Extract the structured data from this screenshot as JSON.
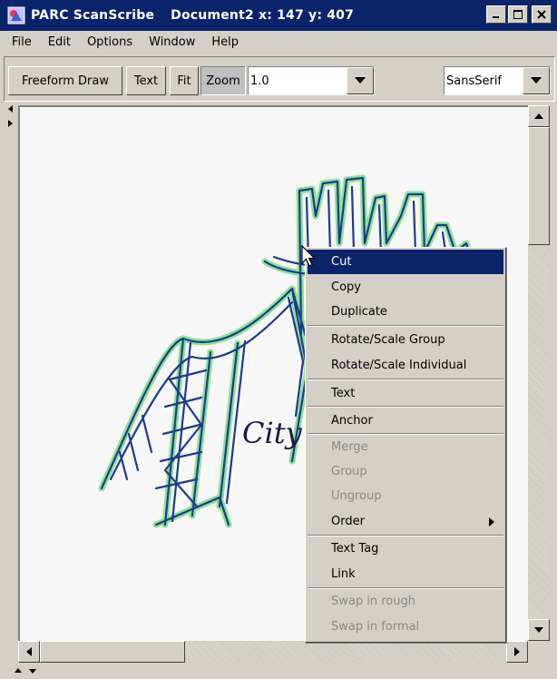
{
  "window": {
    "app_title": "PARC ScanScribe",
    "doc_title": "Document2 x: 147 y: 407"
  },
  "menubar": {
    "items": [
      "File",
      "Edit",
      "Options",
      "Window",
      "Help"
    ]
  },
  "toolbar": {
    "freeform_label": "Freeform Draw",
    "text_label": "Text",
    "fit_label": "Fit",
    "zoom_label": "Zoom",
    "zoom_value": "1.0",
    "font_value": "SansSerif"
  },
  "canvas": {
    "sketch_text": "City"
  },
  "context_menu": {
    "cut": "Cut",
    "copy": "Copy",
    "duplicate": "Duplicate",
    "rotate_group": "Rotate/Scale Group",
    "rotate_individual": "Rotate/Scale Individual",
    "text": "Text",
    "anchor": "Anchor",
    "merge": "Merge",
    "group": "Group",
    "ungroup": "Ungroup",
    "order": "Order",
    "text_tag": "Text Tag",
    "link": "Link",
    "swap_rough": "Swap in rough",
    "swap_formal": "Swap in formal"
  },
  "colors": {
    "titlebar": "#0a246a",
    "highlight": "#0a246a",
    "sketch_ink": "#1e3a8a",
    "sketch_glow": "#7ee08a"
  }
}
